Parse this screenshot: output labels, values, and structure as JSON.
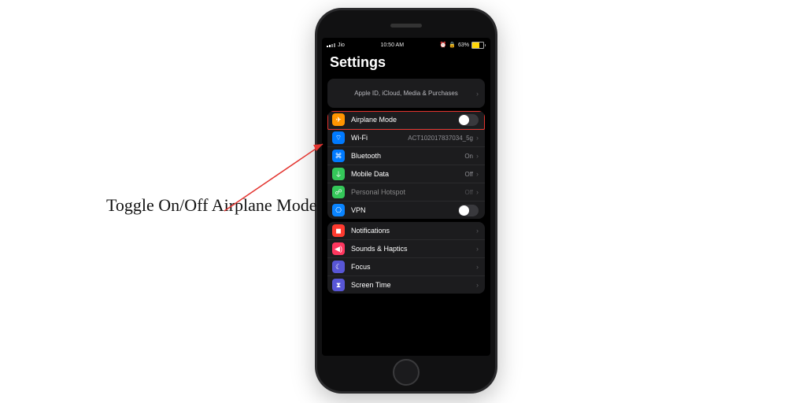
{
  "statusbar": {
    "carrier": "Jio",
    "time": "10:50 AM",
    "battery_pct": "63%",
    "lock": "🔒",
    "alarm": "⏰"
  },
  "page": {
    "title": "Settings"
  },
  "apple_id": {
    "text": "Apple ID, iCloud, Media & Purchases"
  },
  "group1": [
    {
      "key": "airplane",
      "label": "Airplane Mode",
      "icon": "✈",
      "cls": "ic-orange",
      "toggle": true
    },
    {
      "key": "wifi",
      "label": "Wi-Fi",
      "detail": "ACT102017837034_5g",
      "icon": "⌔",
      "cls": "ic-blue",
      "chev": true
    },
    {
      "key": "bluetooth",
      "label": "Bluetooth",
      "detail": "On",
      "icon": "⌘",
      "cls": "ic-blue",
      "chev": true
    },
    {
      "key": "mobile",
      "label": "Mobile Data",
      "detail": "Off",
      "icon": "⏚",
      "cls": "ic-green",
      "chev": true
    },
    {
      "key": "hotspot",
      "label": "Personal Hotspot",
      "detail": "Off",
      "icon": "☍",
      "cls": "ic-green",
      "chev": true,
      "dim": true
    },
    {
      "key": "vpn",
      "label": "VPN",
      "icon": "⎔",
      "cls": "ic-blue2",
      "toggle": true
    }
  ],
  "group2": [
    {
      "key": "notifications",
      "label": "Notifications",
      "icon": "◼",
      "cls": "ic-red",
      "chev": true
    },
    {
      "key": "sounds",
      "label": "Sounds & Haptics",
      "icon": "◀︎)",
      "cls": "ic-pink",
      "chev": true
    },
    {
      "key": "focus",
      "label": "Focus",
      "icon": "☾",
      "cls": "ic-indigo",
      "chev": true
    },
    {
      "key": "screentime",
      "label": "Screen Time",
      "icon": "⧗",
      "cls": "ic-indigo",
      "chev": true
    }
  ],
  "annotation": "Toggle On/Off Airplane Mode",
  "colors": {
    "highlight": "#e3342f"
  }
}
